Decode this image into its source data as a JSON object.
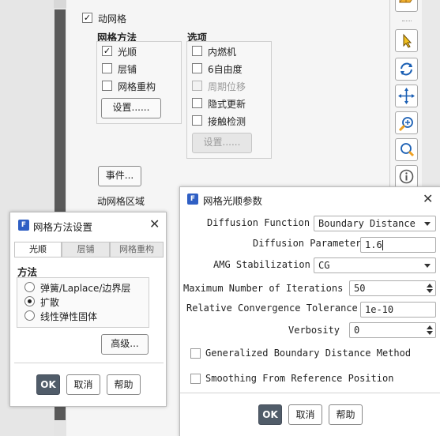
{
  "main": {
    "dynamic_mesh_label": "动网格",
    "mesh_methods": {
      "title": "网格方法",
      "items": [
        {
          "label": "光顺",
          "checked": true
        },
        {
          "label": "层铺",
          "checked": false
        },
        {
          "label": "网格重构",
          "checked": false
        }
      ],
      "settings_label": "设置......"
    },
    "options": {
      "title": "选项",
      "items": [
        {
          "label": "内燃机",
          "checked": false,
          "disabled": false
        },
        {
          "label": "6自由度",
          "checked": false,
          "disabled": false
        },
        {
          "label": "周期位移",
          "checked": false,
          "disabled": true
        },
        {
          "label": "隐式更新",
          "checked": false,
          "disabled": false
        },
        {
          "label": "接触检测",
          "checked": false,
          "disabled": false
        }
      ],
      "settings_label": "设置......"
    },
    "events_label": "事件...",
    "zones_label": "动网格区域"
  },
  "toolbar": {
    "icons": [
      "open-folder-icon",
      "pointer-icon",
      "rotate-icon",
      "pan-icon",
      "zoom-in-icon",
      "zoom-fit-icon",
      "info-icon"
    ]
  },
  "method_dialog": {
    "logo": "F",
    "title": "网格方法设置",
    "tabs": [
      "光顺",
      "层铺",
      "网格重构"
    ],
    "method_title": "方法",
    "methods": [
      {
        "label": "弹簧/Laplace/边界层",
        "selected": false
      },
      {
        "label": "扩散",
        "selected": true
      },
      {
        "label": "线性弹性固体",
        "selected": false
      }
    ],
    "advanced_label": "高级...",
    "ok_label": "OK",
    "cancel_label": "取消",
    "help_label": "帮助"
  },
  "smoothing_dialog": {
    "logo": "F",
    "title": "网格光顺参数",
    "diffusion_function_label": "Diffusion Function",
    "diffusion_function_value": "Boundary Distance",
    "diffusion_parameter_label": "Diffusion Parameter",
    "diffusion_parameter_value": "1.6",
    "amg_label": "AMG Stabilization",
    "amg_value": "CG",
    "max_iter_label": "Maximum Number of Iterations",
    "max_iter_value": "50",
    "tolerance_label": "Relative Convergence Tolerance",
    "tolerance_value": "1e-10",
    "verbosity_label": "Verbosity",
    "verbosity_value": "0",
    "gbdm_label": "Generalized Boundary Distance Method",
    "gbdm_checked": false,
    "sfrp_label": "Smoothing From Reference Position",
    "sfrp_checked": false,
    "ok_label": "OK",
    "cancel_label": "取消",
    "help_label": "帮助"
  },
  "colors": {
    "ok_button": "#505c69",
    "logo": "#2f5fc4",
    "scroll_thumb": "#5a5a5a"
  }
}
